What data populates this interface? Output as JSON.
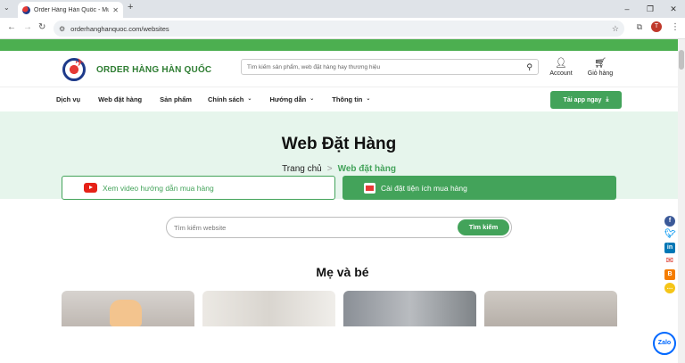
{
  "browser": {
    "tab_title": "Order Hàng Hàn Quốc - Mua H",
    "url": "orderhanghanquoc.com/websites",
    "profile_initial": "T"
  },
  "header": {
    "brand": "ORDER HÀNG HÀN QUỐC",
    "search_placeholder": "Tìm kiếm sản phẩm, web đặt hàng hay thương hiệu",
    "account_label": "Account",
    "cart_label": "Giỏ hàng"
  },
  "nav": {
    "items": [
      "Dịch vụ",
      "Web đặt hàng",
      "Sản phẩm",
      "Chính sách",
      "Hướng dẫn",
      "Thông tin"
    ],
    "app_button": "Tải app ngay"
  },
  "hero": {
    "title": "Web Đặt Hàng",
    "breadcrumb_home": "Trang chủ",
    "breadcrumb_separator": ">",
    "breadcrumb_current": "Web đặt hàng"
  },
  "actions": {
    "video_button": "Xem video hướng dẫn mua hàng",
    "extension_button": "Cài đặt tiện ích mua hàng"
  },
  "website_search": {
    "placeholder": "Tìm kiếm website",
    "button": "Tìm kiếm"
  },
  "section": {
    "title": "Mẹ và bé"
  },
  "colors": {
    "brand_green": "#43a35a",
    "top_strip": "#4caf50",
    "hero_bg": "#e6f5ec"
  },
  "floating": {
    "zalo": "Zalo"
  }
}
